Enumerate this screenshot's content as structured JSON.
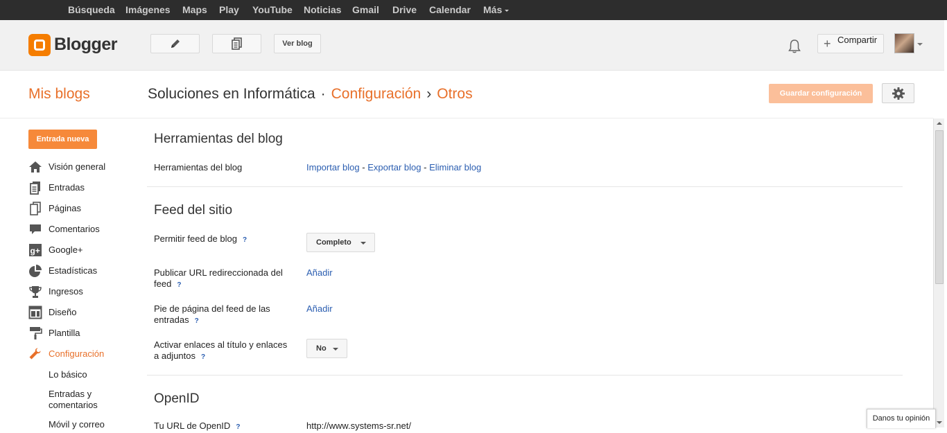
{
  "google_bar": {
    "items": [
      "Búsqueda",
      "Imágenes",
      "Maps",
      "Play",
      "YouTube",
      "Noticias",
      "Gmail",
      "Drive",
      "Calendar",
      "Más"
    ]
  },
  "header": {
    "logo_text": "Blogger",
    "view_blog_label": "Ver blog",
    "share_label": "Compartir"
  },
  "title_row": {
    "my_blogs": "Mis blogs",
    "blog_name": "Soluciones en Informática",
    "crumb_settings": "Configuración",
    "crumb_other": "Otros",
    "save_label": "Guardar configuración"
  },
  "sidebar": {
    "new_post_label": "Entrada nueva",
    "items": [
      {
        "label": "Visión general",
        "icon": "home-icon"
      },
      {
        "label": "Entradas",
        "icon": "posts-icon"
      },
      {
        "label": "Páginas",
        "icon": "pages-icon"
      },
      {
        "label": "Comentarios",
        "icon": "comments-icon"
      },
      {
        "label": "Google+",
        "icon": "google-plus-icon"
      },
      {
        "label": "Estadísticas",
        "icon": "stats-icon"
      },
      {
        "label": "Ingresos",
        "icon": "trophy-icon"
      },
      {
        "label": "Diseño",
        "icon": "layout-icon"
      },
      {
        "label": "Plantilla",
        "icon": "template-icon"
      },
      {
        "label": "Configuración",
        "icon": "wrench-icon"
      }
    ],
    "sub_items": [
      "Lo básico",
      "Entradas y comentarios",
      "Móvil y correo"
    ]
  },
  "content": {
    "tools": {
      "heading": "Herramientas del blog",
      "label": "Herramientas del blog",
      "import": "Importar blog",
      "export": "Exportar blog",
      "delete": "Eliminar blog",
      "dash": "-"
    },
    "feed": {
      "heading": "Feed del sitio",
      "allow_label": "Permitir feed de blog",
      "allow_value": "Completo",
      "redirect_label": "Publicar URL redireccionada del feed",
      "redirect_action": "Añadir",
      "footer_label": "Pie de página del feed de las entradas",
      "footer_action": "Añadir",
      "links_label": "Activar enlaces al título y enlaces a adjuntos",
      "links_value": "No",
      "help": "?"
    },
    "openid": {
      "heading": "OpenID",
      "url_label": "Tu URL de OpenID",
      "url_value": "http://www.systems-sr.net/"
    }
  },
  "feedback_label": "Danos tu opinión",
  "colors": {
    "accent": "#e8702a",
    "link": "#2a5db0",
    "save_disabled": "#fbbf9a",
    "new_post": "#f6893a"
  }
}
